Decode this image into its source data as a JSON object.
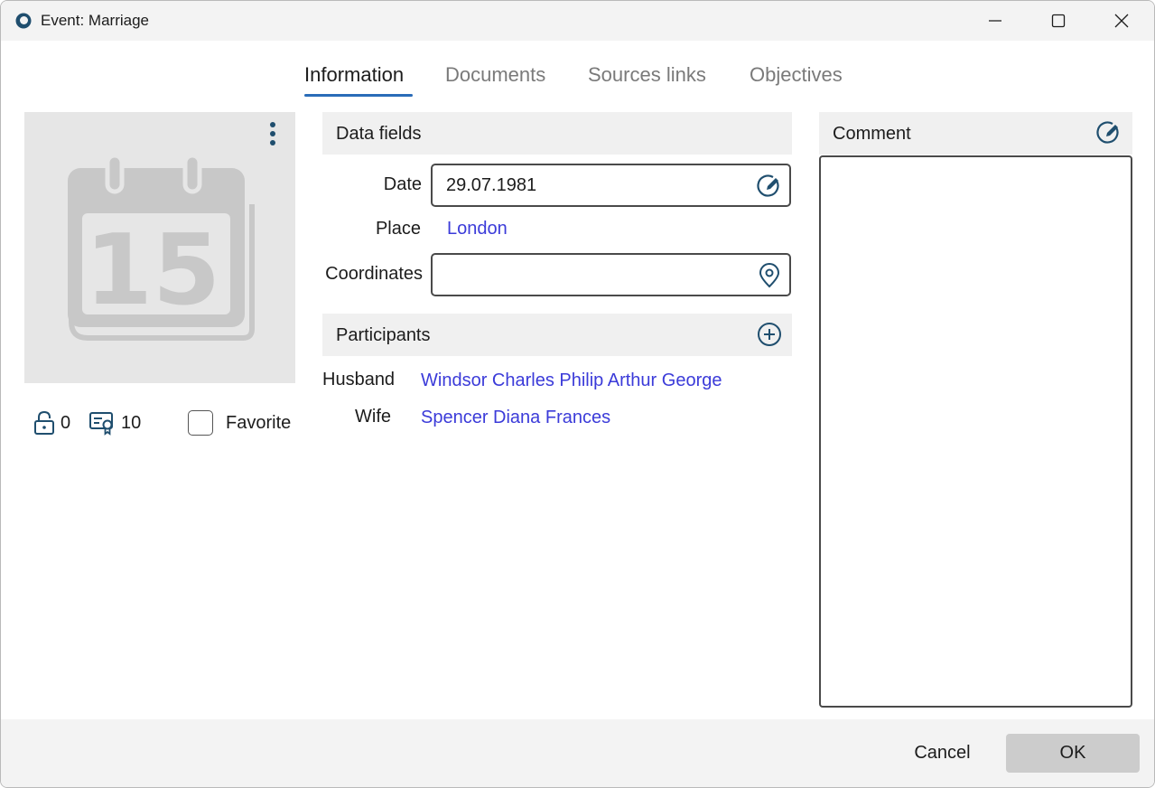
{
  "window": {
    "title": "Event: Marriage"
  },
  "tabs": [
    {
      "label": "Information",
      "active": true
    },
    {
      "label": "Documents",
      "active": false
    },
    {
      "label": "Sources links",
      "active": false
    },
    {
      "label": "Objectives",
      "active": false
    }
  ],
  "photo": {
    "icon": "calendar-icon",
    "day": "15"
  },
  "stats": {
    "lock_count": "0",
    "certificate_count": "10"
  },
  "favorite": {
    "label": "Favorite",
    "checked": false
  },
  "data_fields": {
    "header": "Data fields",
    "date_label": "Date",
    "date_value": "29.07.1981",
    "place_label": "Place",
    "place_value": "London",
    "coordinates_label": "Coordinates",
    "coordinates_value": ""
  },
  "participants": {
    "header": "Participants",
    "rows": [
      {
        "role": "Husband",
        "name": "Windsor Charles Philip Arthur George"
      },
      {
        "role": "Wife",
        "name": "Spencer Diana Frances"
      }
    ]
  },
  "comment": {
    "header": "Comment",
    "value": ""
  },
  "footer": {
    "cancel_label": "Cancel",
    "ok_label": "OK"
  },
  "colors": {
    "accent": "#2a6cb8",
    "link": "#3b3bd9",
    "icon": "#1f4e6e"
  }
}
